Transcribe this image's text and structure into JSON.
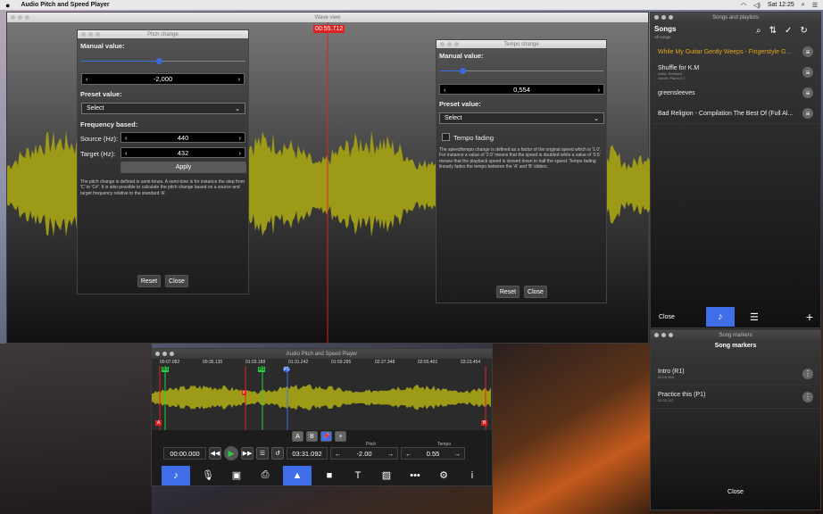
{
  "menubar": {
    "app_name": "Audio Pitch and Speed Player",
    "clock": "Sat 12:25",
    "apple": "",
    "wifi_icon": "wifi-icon",
    "volume_icon": "volume-icon"
  },
  "wave_view": {
    "title": "Wave view",
    "playhead_time": "00:55.712"
  },
  "pitch": {
    "title": "Pitch change",
    "manual_label": "Manual value:",
    "manual_value": "-2,000",
    "preset_label": "Preset value:",
    "preset_select": "Select",
    "freq_label": "Frequency based:",
    "source_label": "Source (Hz):",
    "source_value": "440",
    "target_label": "Target (Hz):",
    "target_value": "432",
    "apply": "Apply",
    "help": "The pitch change is defined in semi-tones. A semi-tone is for instance the step from 'C' to 'C#'. It is also possible to calculate the pitch change based on a source and target frequency relative to the standard 'A'.",
    "reset": "Reset",
    "close": "Close"
  },
  "tempo": {
    "title": "Tempo change",
    "manual_label": "Manual value:",
    "manual_value": "0,554",
    "preset_label": "Preset value:",
    "preset_select": "Select",
    "fading_label": "Tempo fading",
    "help": "The speed/tempo change is defined as a factor of the original speed which is '1.0'. For instance a value of '2.0' means that the speed is doubled while a value of '0.5' means that the playback speed is slowed down to half the speed. Tempo fading linearly fades the tempo between the 'A' and 'B' sliders.",
    "reset": "Reset",
    "close": "Close"
  },
  "songs": {
    "title": "Songs and playlists",
    "header": "Songs",
    "sub": "All songs",
    "items": [
      {
        "title": "While My Guitar Gently Weeps - Fingerstyle G...",
        "meta": "",
        "active": true
      },
      {
        "title": "Shuffle for K.M",
        "meta": "Artist: Jimiband\nAlbum: Piano 5.7",
        "active": false
      },
      {
        "title": "greensleeves",
        "meta": "",
        "active": false
      },
      {
        "title": "Bad Religion - Compilation The Best Of (Full Al...",
        "meta": "",
        "active": false
      }
    ],
    "close": "Close"
  },
  "markers": {
    "title": "Song markers",
    "header": "Song markers",
    "items": [
      {
        "name": "Intro (R1)",
        "time": "00:05.965"
      },
      {
        "name": "Practice this (P1)",
        "time": "01:23.112"
      }
    ],
    "close": "Close"
  },
  "player": {
    "title": "Audio Pitch and Speed Player",
    "ticks": [
      "00:07.082",
      "00:35.135",
      "01:03.188",
      "01:31.242",
      "01:59.295",
      "02:27.348",
      "02:55.401",
      "03:23.454"
    ],
    "marker_r1": "R1",
    "marker_r1b": "R1",
    "marker_p1": "P1",
    "marker_a": "A",
    "marker_b": "B",
    "marker_x": "x",
    "ab_a": "A",
    "ab_b": "B",
    "ab_plus": "+",
    "current_time": "00:00.000",
    "total_time": "03:31.092",
    "pitch_label": "Pitch",
    "pitch_value": "-2.00",
    "tempo_label": "Tempo",
    "tempo_value": "0.55"
  },
  "colors": {
    "accent": "#3f6ee8",
    "wave": "#9d9a18",
    "active_song": "#e3a41c",
    "playhead": "#e02020"
  }
}
